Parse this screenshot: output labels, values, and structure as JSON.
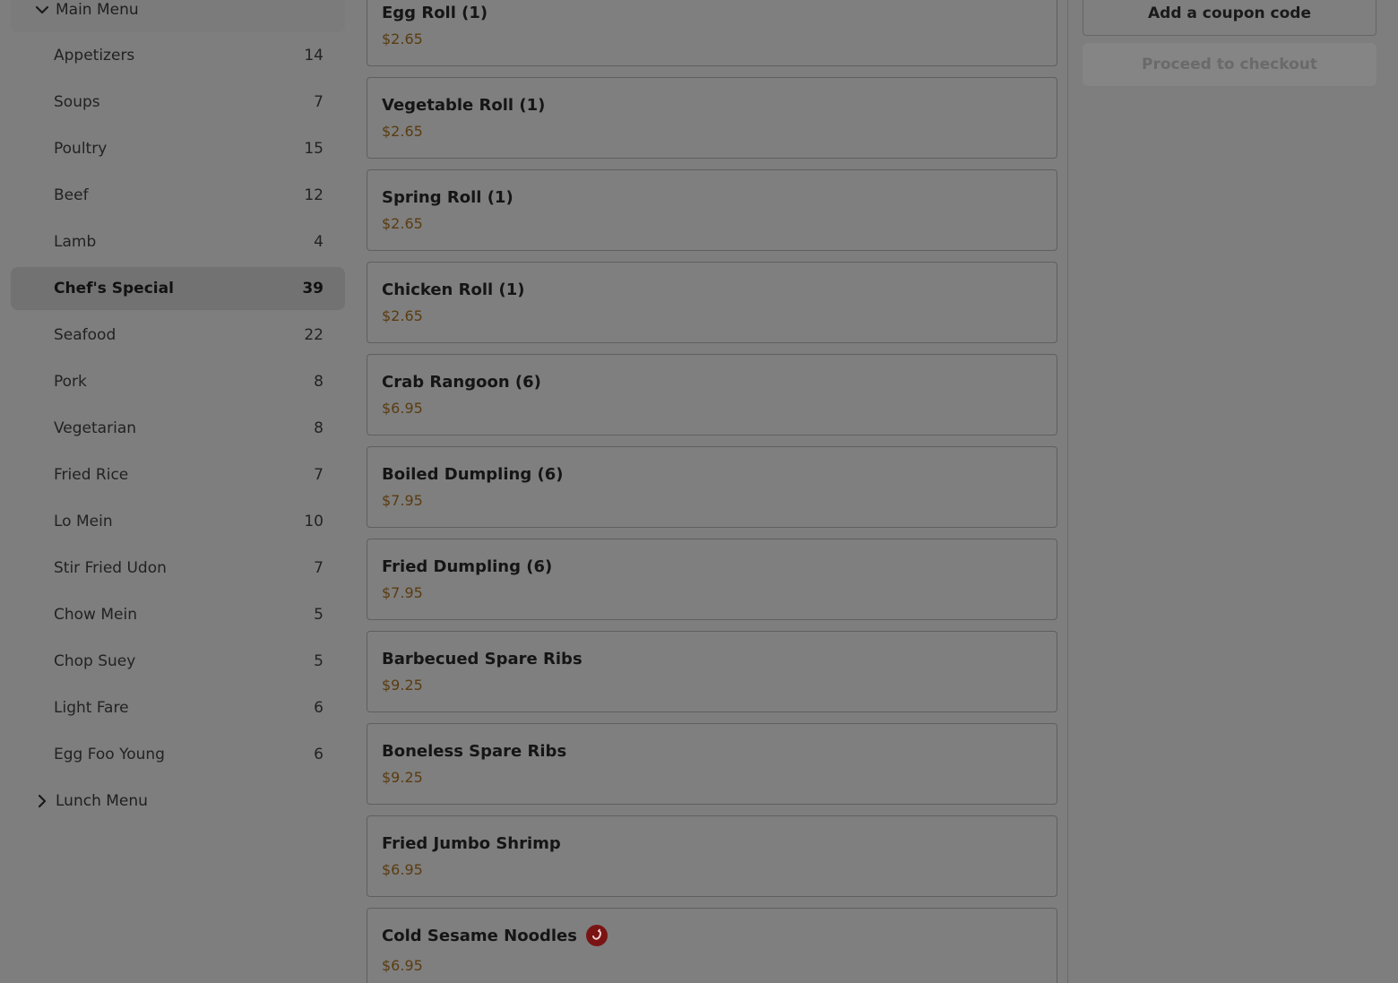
{
  "sidebar": {
    "main_menu_label": "Main Menu",
    "categories": [
      {
        "label": "Appetizers",
        "count": "14"
      },
      {
        "label": "Soups",
        "count": "7"
      },
      {
        "label": "Poultry",
        "count": "15"
      },
      {
        "label": "Beef",
        "count": "12"
      },
      {
        "label": "Lamb",
        "count": "4"
      },
      {
        "label": "Chef's Special",
        "count": "39"
      },
      {
        "label": "Seafood",
        "count": "22"
      },
      {
        "label": "Pork",
        "count": "8"
      },
      {
        "label": "Vegetarian",
        "count": "8"
      },
      {
        "label": "Fried Rice",
        "count": "7"
      },
      {
        "label": "Lo Mein",
        "count": "10"
      },
      {
        "label": "Stir Fried Udon",
        "count": "7"
      },
      {
        "label": "Chow Mein",
        "count": "5"
      },
      {
        "label": "Chop Suey",
        "count": "5"
      },
      {
        "label": "Light Fare",
        "count": "6"
      },
      {
        "label": "Egg Foo Young",
        "count": "6"
      }
    ],
    "active_category": "Chef's Special",
    "lunch_menu_label": "Lunch Menu"
  },
  "items": [
    {
      "name": "Egg Roll (1)",
      "price": "$2.65"
    },
    {
      "name": "Vegetable Roll (1)",
      "price": "$2.65"
    },
    {
      "name": "Spring Roll (1)",
      "price": "$2.65"
    },
    {
      "name": "Chicken Roll (1)",
      "price": "$2.65"
    },
    {
      "name": "Crab Rangoon (6)",
      "price": "$6.95"
    },
    {
      "name": "Boiled Dumpling (6)",
      "price": "$7.95"
    },
    {
      "name": "Fried Dumpling (6)",
      "price": "$7.95"
    },
    {
      "name": "Barbecued Spare Ribs",
      "price": "$9.25"
    },
    {
      "name": "Boneless Spare Ribs",
      "price": "$9.25"
    },
    {
      "name": "Fried Jumbo Shrimp",
      "price": "$6.95"
    },
    {
      "name": "Cold Sesame Noodles",
      "price": "$6.95",
      "spicy": true
    }
  ],
  "cart": {
    "coupon_label": "Add a coupon code",
    "checkout_label": "Proceed to checkout"
  },
  "icons": {
    "chevron_down": "chevron-down-icon",
    "chevron_right": "chevron-right-icon",
    "spicy": "chili-pepper-icon"
  },
  "colors": {
    "price": "#5a3c10",
    "spicy_badge": "#7a1414"
  }
}
